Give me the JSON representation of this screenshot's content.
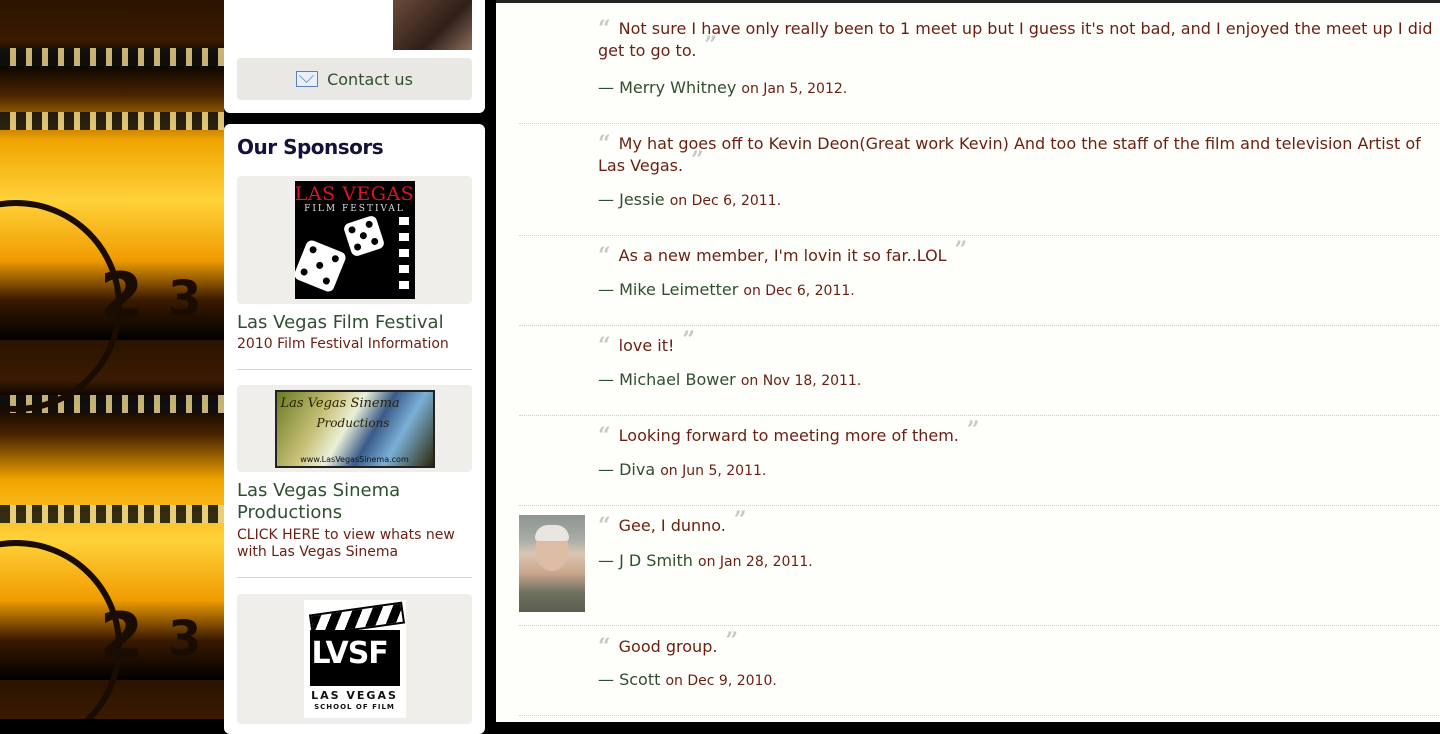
{
  "sidebar": {
    "contact_label": "Contact us",
    "sponsors_title": "Our Sponsors",
    "sponsors": [
      {
        "name": "Las Vegas Film Festival",
        "desc": "2010 Film Festival Information",
        "logo_line1": "LAS VEGAS",
        "logo_line2": "FILM FESTIVAL"
      },
      {
        "name": "Las Vegas Sinema Productions",
        "desc": "CLICK HERE to view whats new with Las Vegas Sinema",
        "logo_line1": "Las Vegas Sinema",
        "logo_line2": "Productions",
        "logo_line3": "www.LasVegasSinema.com"
      },
      {
        "name": "",
        "desc": "",
        "logo_letters": "LVSF",
        "logo_line1": "LAS VEGAS",
        "logo_line2": "SCHOOL OF FILM"
      }
    ]
  },
  "testimonials": [
    {
      "text": "Not sure I have only really been to 1 meet up but I guess it's not bad, and I enjoyed the meet up I did get to go to.",
      "author": "Merry Whitney",
      "date": "on Jan 5, 2012."
    },
    {
      "text": "My hat goes off to Kevin Deon(Great work Kevin) And too the staff of the film and television Artist of Las Vegas.",
      "author": "Jessie",
      "date": "on Dec 6, 2011."
    },
    {
      "text": "As a new member, I'm lovin it so far..LOL",
      "author": "Mike Leimetter",
      "date": "on Dec 6, 2011."
    },
    {
      "text": "love it!",
      "author": "Michael Bower",
      "date": "on Nov 18, 2011."
    },
    {
      "text": "Looking forward to meeting more of them.",
      "author": "Diva",
      "date": "on Jun 5, 2011."
    },
    {
      "text": "Gee, I dunno.",
      "author": "J D Smith",
      "date": "on Jan 28, 2011."
    },
    {
      "text": "Good group.",
      "author": "Scott",
      "date": "on Dec 9, 2010."
    }
  ],
  "quote_open": "“",
  "quote_close": "”",
  "dash": "— ",
  "reel_numbers": [
    "2",
    "3",
    "2",
    "3"
  ]
}
